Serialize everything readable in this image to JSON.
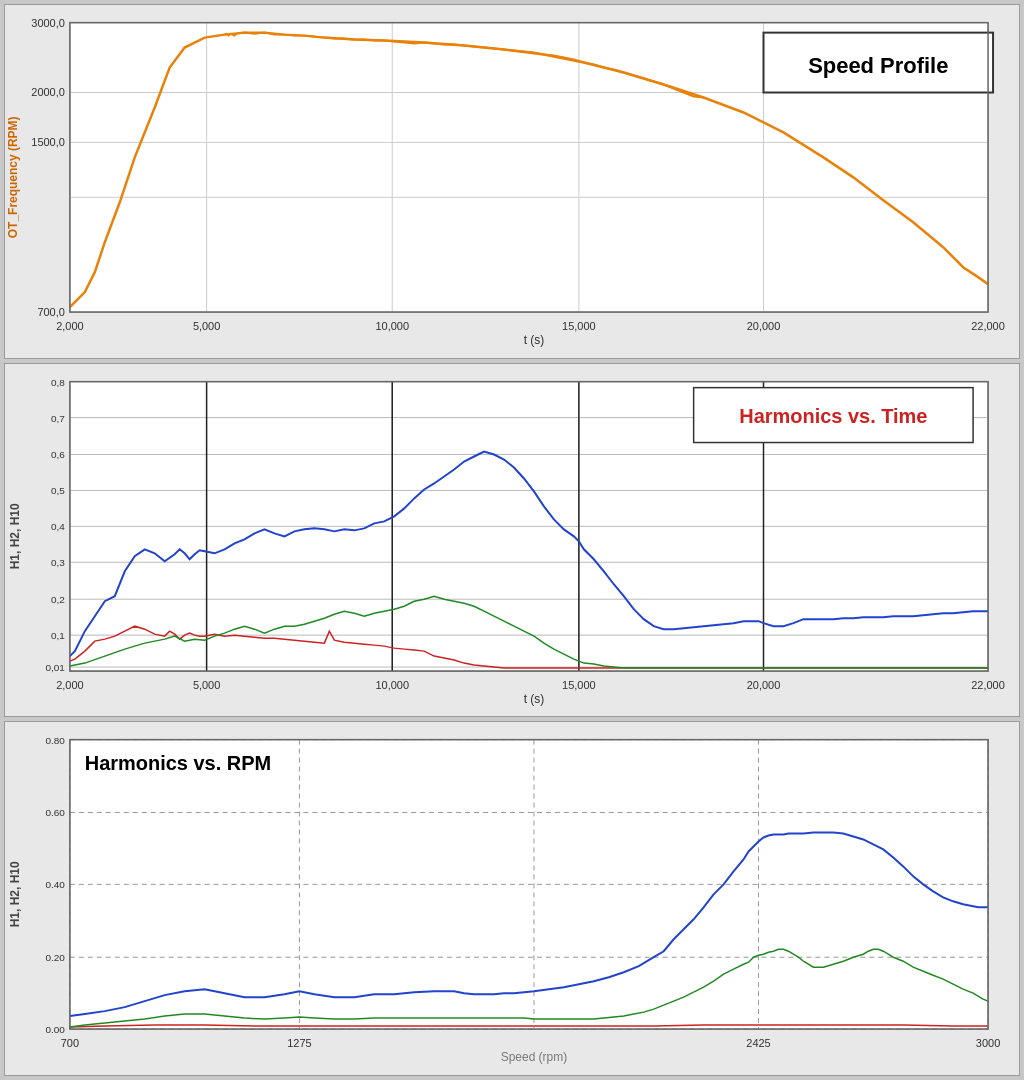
{
  "charts": {
    "speed_profile": {
      "title": "Speed Profile",
      "x_label": "t (s)",
      "y_label": "OT_Frequency (RPM)",
      "x_ticks": [
        "2,000",
        "5,000",
        "10,000",
        "15,000",
        "20,000",
        "22,000"
      ],
      "y_ticks": [
        "700,0",
        "1500,0",
        "2000,0",
        "3000,0"
      ],
      "colors": {
        "curve": "#e8820a"
      }
    },
    "harmonics_time": {
      "title": "Harmonics vs. Time",
      "x_label": "t (s)",
      "y_label": "H1, H2, H10",
      "x_ticks": [
        "2,000",
        "5,000",
        "10,000",
        "15,000",
        "20,000",
        "22,000"
      ],
      "y_ticks": [
        "0,01",
        "0,1",
        "0,2",
        "0,3",
        "0,4",
        "0,5",
        "0,6",
        "0,7",
        "0,8"
      ],
      "colors": {
        "h1": "#2244cc",
        "h2": "#cc2222",
        "h10": "#228822"
      }
    },
    "harmonics_rpm": {
      "title": "Harmonics vs. RPM",
      "x_label": "Speed (rpm)",
      "y_label": "H1, H2, H10",
      "x_ticks": [
        "700",
        "1275",
        "2425",
        "3000"
      ],
      "y_ticks": [
        "0.00",
        "0.20",
        "0.40",
        "0.60",
        "0.80"
      ],
      "colors": {
        "h1": "#2244cc",
        "h2": "#cc2222",
        "h10": "#228822"
      }
    }
  }
}
